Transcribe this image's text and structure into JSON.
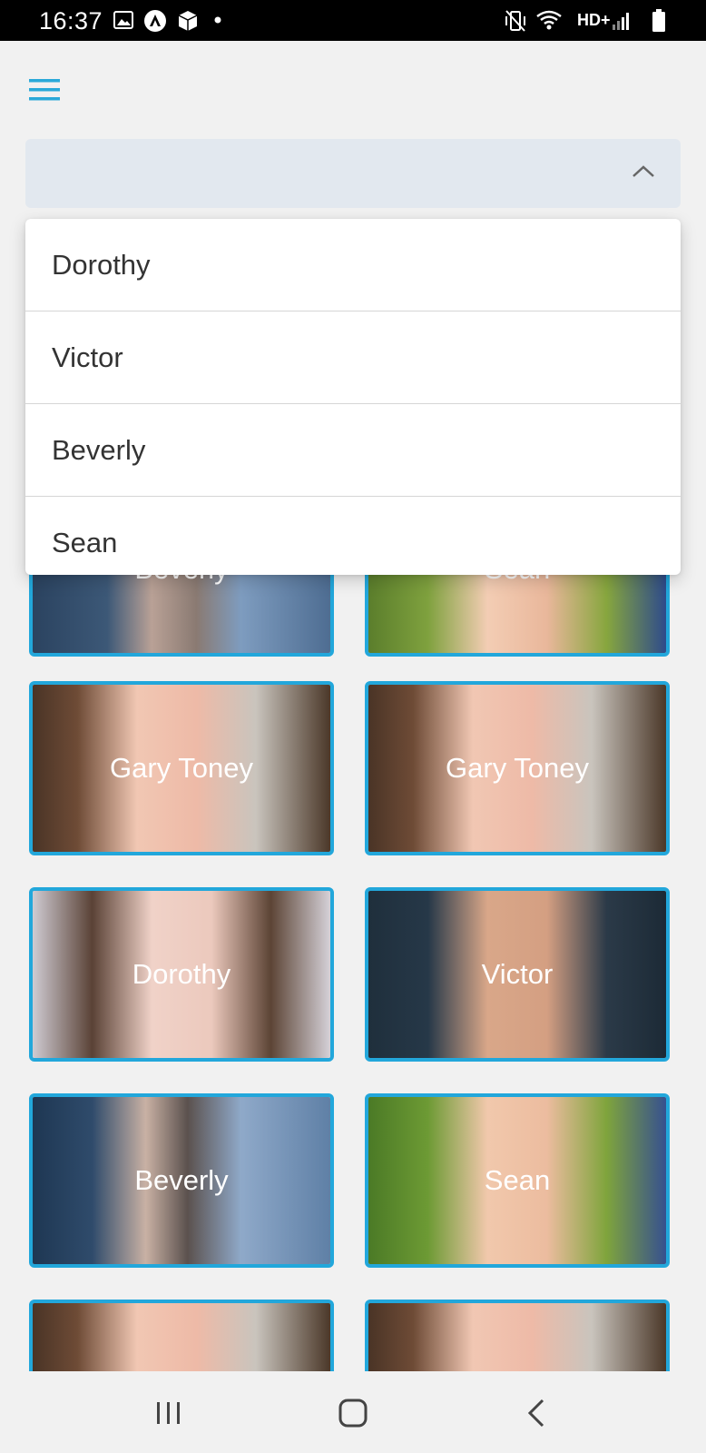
{
  "status_bar": {
    "time": "16:37",
    "network_label": "HD+",
    "left_icons": [
      "image-icon",
      "android-notify-icon",
      "box-icon",
      "dot-icon"
    ],
    "right_icons": [
      "vibrate-icon",
      "wifi-icon",
      "signal-icon",
      "battery-icon"
    ]
  },
  "header": {
    "menu_icon": "hamburger-menu-icon"
  },
  "select": {
    "selected_value": "",
    "chevron_icon": "chevron-up-icon"
  },
  "dropdown": {
    "options": [
      "Dorothy",
      "Victor",
      "Beverly",
      "Sean"
    ]
  },
  "cards": [
    {
      "name": "Beverly"
    },
    {
      "name": "Sean"
    },
    {
      "name": "Gary  Toney"
    },
    {
      "name": "Gary  Toney"
    },
    {
      "name": "Dorothy"
    },
    {
      "name": "Victor"
    },
    {
      "name": "Beverly"
    },
    {
      "name": "Sean"
    },
    {
      "name": ""
    },
    {
      "name": ""
    }
  ],
  "nav_bar": {
    "recents_icon": "recents-icon",
    "home_icon": "home-icon",
    "back_icon": "back-icon"
  },
  "colors": {
    "accent": "#22a7db",
    "background": "#f1f1f1",
    "select_bg": "#e2e8ef"
  }
}
